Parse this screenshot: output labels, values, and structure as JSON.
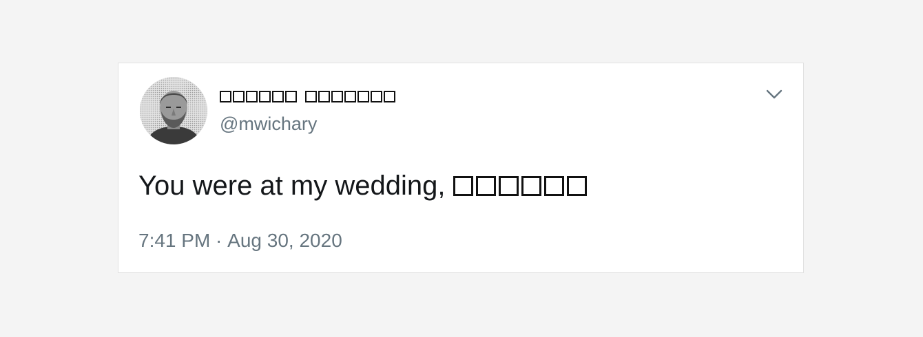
{
  "tweet": {
    "display_name_chars_word1": 6,
    "display_name_chars_word2": 7,
    "handle": "@mwichary",
    "text": "You were at my wedding,",
    "text_unrendered_glyph_count": 6,
    "time": "7:41 PM",
    "separator": " · ",
    "date": "Aug 30, 2020"
  },
  "icons": {
    "menu": "chevron-down-icon",
    "avatar": "avatar"
  },
  "colors": {
    "background": "#f4f4f4",
    "card": "#ffffff",
    "card_border": "#e1e1e1",
    "primary_text": "#14171a",
    "secondary_text": "#66757f"
  }
}
